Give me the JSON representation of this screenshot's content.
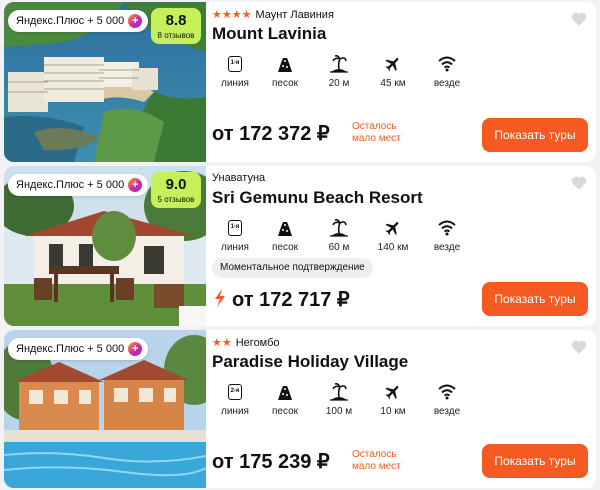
{
  "hotels": [
    {
      "plus_label": "Яндекс.Плюс + 5 000",
      "rating": "8.8",
      "reviews": "8 отзывов",
      "rating_color": "#c5f05a",
      "stars_count": 4,
      "stars": "★★★★",
      "location": "Маунт Лавиния",
      "name": "Mount Lavinia",
      "features": [
        {
          "icon": "lane-1-icon",
          "badge": "1-я",
          "label": "линия"
        },
        {
          "icon": "sand-icon",
          "label": "песок"
        },
        {
          "icon": "beach-distance-icon",
          "label": "20 м"
        },
        {
          "icon": "airport-distance-icon",
          "label": "45 км"
        },
        {
          "icon": "wifi-icon",
          "label": "везде"
        }
      ],
      "price": "от 172 372 ₽",
      "seats_left": "Осталось мало мест",
      "button": "Показать туры"
    },
    {
      "plus_label": "Яндекс.Плюс + 5 000",
      "rating": "9.0",
      "reviews": "5 отзывов",
      "rating_color": "#c5f05a",
      "stars_count": 0,
      "stars": "",
      "location": "Унаватуна",
      "name": "Sri Gemunu Beach Resort",
      "features": [
        {
          "icon": "lane-1-icon",
          "badge": "1-я",
          "label": "линия"
        },
        {
          "icon": "sand-icon",
          "label": "песок"
        },
        {
          "icon": "beach-distance-icon",
          "label": "60 м"
        },
        {
          "icon": "airport-distance-icon",
          "label": "140 км"
        },
        {
          "icon": "wifi-icon",
          "label": "везде"
        }
      ],
      "instant_confirm": "Моментальное подтверждение",
      "price": "от 172 717 ₽",
      "button": "Показать туры"
    },
    {
      "plus_label": "Яндекс.Плюс + 5 000",
      "stars_count": 2,
      "stars": "★★",
      "location": "Негомбо",
      "name": "Paradise Holiday Village",
      "features": [
        {
          "icon": "lane-2-icon",
          "badge": "2-я",
          "label": "линия"
        },
        {
          "icon": "sand-icon",
          "label": "песок"
        },
        {
          "icon": "beach-distance-icon",
          "label": "100 м"
        },
        {
          "icon": "airport-distance-icon",
          "label": "10 км"
        },
        {
          "icon": "wifi-icon",
          "label": "везде"
        }
      ],
      "price": "от 175 239 ₽",
      "seats_left": "Осталось мало мест",
      "button": "Показать туры"
    }
  ],
  "colors": {
    "accent": "#f45a22",
    "rating": "#c5f05a"
  }
}
